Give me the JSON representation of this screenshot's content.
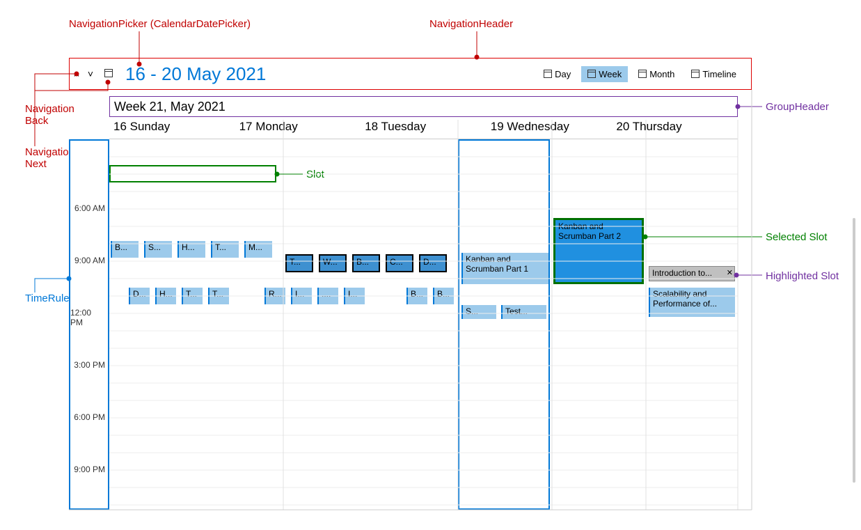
{
  "annotations": {
    "nav_picker": "NavigationPicker (CalendarDatePicker)",
    "nav_header": "NavigationHeader",
    "nav_back": "Navigation\nBack",
    "nav_next": "Navigation\nNext",
    "time_ruler": "TimeRuler",
    "slot": "Slot",
    "group_header": "GroupHeader",
    "selected_slot": "Selected Slot",
    "highlighted_slot": "Highlighted Slot"
  },
  "header": {
    "title": "16  - 20 May 2021",
    "views": [
      {
        "label": "Day",
        "active": false
      },
      {
        "label": "Week",
        "active": true
      },
      {
        "label": "Month",
        "active": false
      },
      {
        "label": "Timeline",
        "active": false
      }
    ]
  },
  "group_header": "Week 21, May 2021",
  "days": [
    "16 Sunday",
    "17 Monday",
    "18 Tuesday",
    "19 Wednesday",
    "20 Thursday"
  ],
  "times": [
    "6:00 AM",
    "9:00 AM",
    "12:00 PM",
    "3:00 PM",
    "6:00 PM",
    "9:00 PM"
  ],
  "appointments": {
    "sun_row1": [
      "B...",
      "S...",
      "H...",
      "T...",
      "M..."
    ],
    "mon_row1": [
      "T...",
      "W...",
      "B...",
      "C...",
      "D..."
    ],
    "sun_row2": [
      "D...",
      "H...",
      "T...",
      "T...",
      "R..."
    ],
    "mon_row2": [
      "I...",
      "....",
      "I...",
      "B...",
      "B..."
    ],
    "tue_main": "Kanban and Scrumban Part 1",
    "tue_small": [
      "S...",
      "Test..."
    ],
    "wed_selected": "Kanban and Scrumban Part 2",
    "thu_highlighted": "Introduction to...",
    "thu_below": "Scalability and Performance of..."
  }
}
